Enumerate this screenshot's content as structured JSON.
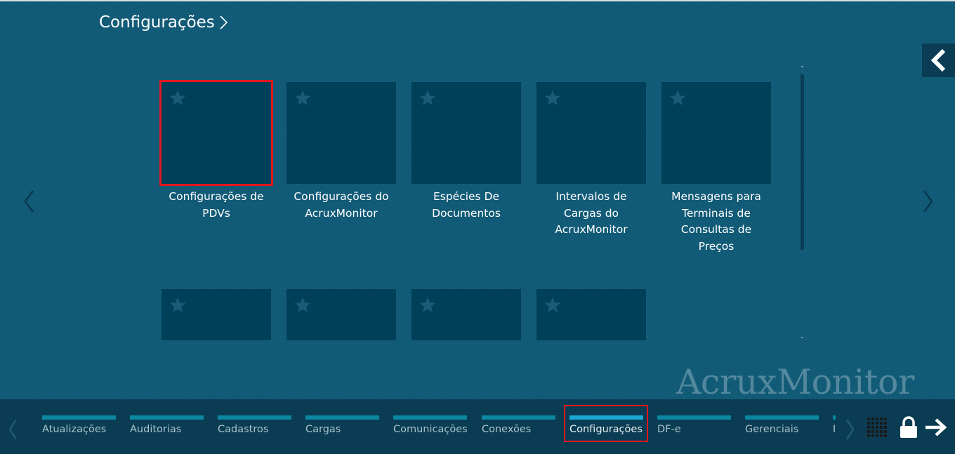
{
  "page": {
    "title": "Configurações",
    "watermark": "AcruxMonitor"
  },
  "tiles_row1": [
    {
      "label_line1": "Configurações de",
      "label_line2": "PDVs",
      "label_line3": "",
      "label_line4": "",
      "selected": true
    },
    {
      "label_line1": "Configurações do",
      "label_line2": "AcruxMonitor",
      "label_line3": "",
      "label_line4": "",
      "selected": false
    },
    {
      "label_line1": "Espécies De",
      "label_line2": "Documentos",
      "label_line3": "",
      "label_line4": "",
      "selected": false
    },
    {
      "label_line1": "Intervalos de",
      "label_line2": "Cargas do",
      "label_line3": "AcruxMonitor",
      "label_line4": "",
      "selected": false
    },
    {
      "label_line1": "Mensagens para",
      "label_line2": "Terminais de",
      "label_line3": "Consultas de",
      "label_line4": "Preços",
      "selected": false
    }
  ],
  "bottom_nav": {
    "tabs": [
      {
        "label": "Atualizações"
      },
      {
        "label": "Auditorias"
      },
      {
        "label": "Cadastros"
      },
      {
        "label": "Cargas"
      },
      {
        "label": "Comunicações"
      },
      {
        "label": "Conexões"
      },
      {
        "label": "Configurações",
        "active": true
      },
      {
        "label": "DF-e"
      },
      {
        "label": "Gerenciais"
      },
      {
        "label": "I"
      }
    ]
  },
  "icons": {
    "title_chevron": "chevron-right-icon",
    "collapse": "chevron-left-icon",
    "page_prev": "chevron-left-icon",
    "page_next": "chevron-right-icon",
    "star": "star-icon",
    "grid": "grid-icon",
    "lock": "lock-icon",
    "logout": "arrow-right-icon"
  },
  "colors": {
    "background": "#0f5a77",
    "tile": "#004059",
    "bar": "#0a3c53",
    "tab_stripe": "#0c87a2",
    "tab_active": "#1aa9d3",
    "highlight": "#e3161d"
  }
}
